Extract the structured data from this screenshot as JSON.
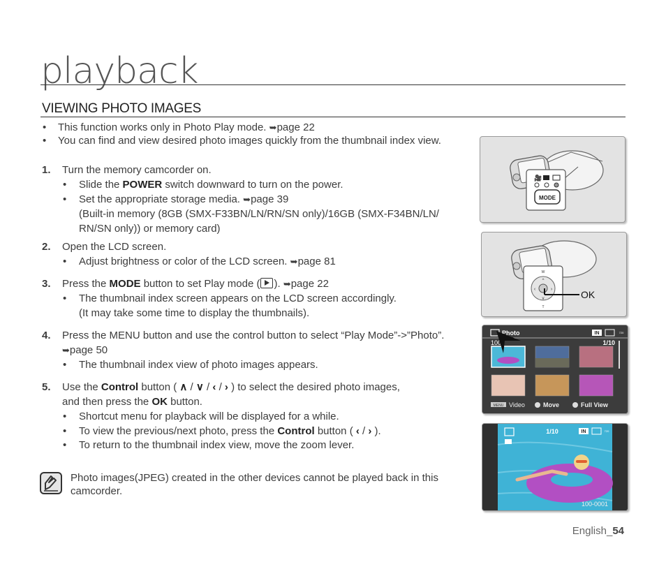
{
  "page": {
    "title": "playback",
    "section_title": "VIEWING PHOTO IMAGES",
    "footer_language": "English_",
    "footer_page": "54"
  },
  "intro_bullets": [
    {
      "text": "This function works only in Photo Play mode. ",
      "ref": "page 22"
    },
    {
      "text": "You can find and view desired photo images quickly from the thumbnail index view."
    }
  ],
  "steps": [
    {
      "number": "1.",
      "text": "Turn the memory camcorder on.",
      "bullets": [
        {
          "pre": "Slide the ",
          "bold": "POWER",
          "post": " switch downward to turn on the power."
        },
        {
          "pre": "Set the appropriate storage media. ",
          "ref": "page 39",
          "cont1": "(Built-in memory (8GB (SMX-F33BN/LN/RN/SN only)/16GB (SMX-F34BN/LN/",
          "cont2": "RN/SN only)) or memory card)"
        }
      ]
    },
    {
      "number": "2.",
      "text": "Open the LCD screen.",
      "bullets": [
        {
          "pre": "Adjust brightness or color of the LCD screen. ",
          "ref": "page 81"
        }
      ]
    },
    {
      "number": "3.",
      "pre": "Press the ",
      "bold": "MODE",
      "post": " button to set Play mode (",
      "post2": "). ",
      "ref": "page 22",
      "bullets": [
        {
          "pre": "The thumbnail index screen appears on the LCD screen accordingly.",
          "cont1": "(It may take some time to display the thumbnails)."
        }
      ]
    },
    {
      "number": "4.",
      "text": "Press the MENU button and use the control button to select “Play Mode”->”Photo”.",
      "ref": "page 50",
      "bullets": [
        {
          "pre": "The thumbnail index view of photo images appears."
        }
      ]
    },
    {
      "number": "5.",
      "pre": "Use the ",
      "bold": "Control",
      "post": " button ( ",
      "controls": [
        "∧",
        "∨",
        "‹",
        "›"
      ],
      "post2": " ) to select the desired photo images,",
      "line2_pre": "and then press the ",
      "line2_bold": "OK",
      "line2_post": " button.",
      "bullets": [
        {
          "pre": "Shortcut menu for playback will be displayed for a while."
        },
        {
          "pre": "To view the previous/next photo, press the ",
          "bold": "Control",
          "post": " button ( ",
          "post2": " )."
        },
        {
          "pre": "To return to the thumbnail index view, move the zoom lever."
        }
      ]
    }
  ],
  "note": {
    "icon": "note-pencil-icon",
    "line1": "Photo images(JPEG) created in the other devices cannot be played back in this",
    "line2": "camcorder."
  },
  "figures": {
    "mode_panel": {
      "button_label": "MODE",
      "indicators": [
        "movie-icon",
        "camera-icon",
        "play-icon"
      ],
      "active_indicator": 2
    },
    "control_panel": {
      "ok_label": "OK",
      "top_label": "W",
      "bottom_label": "T"
    },
    "thumbnail_screen": {
      "mode_label": "Photo",
      "file_prefix": "100-",
      "counter": "1/10",
      "storage_badge": "IN",
      "resolution_badge": "720 VIN",
      "footer_menu": "MENU",
      "footer_video": "Video",
      "footer_move": "Move",
      "footer_full": "Full View",
      "thumbnails": [
        "pool-girl",
        "lake-mountain",
        "pink-forest",
        "beach-sand",
        "desert-person",
        "purple-flowers"
      ],
      "selected_index": 0
    },
    "fullview_screen": {
      "counter": "1/10",
      "storage_badge": "IN",
      "resolution_badge": "720 VIN",
      "file_number": "100-0001"
    }
  },
  "colors": {
    "text": "#3c3c3c",
    "rule": "#333333",
    "figure_bg": "#e3e3e3",
    "screen_bg": "#3c3c3c",
    "pool_blue": "#3fb3d6",
    "tube_purple": "#b24fc3"
  },
  "arrow_glyph": "➥"
}
